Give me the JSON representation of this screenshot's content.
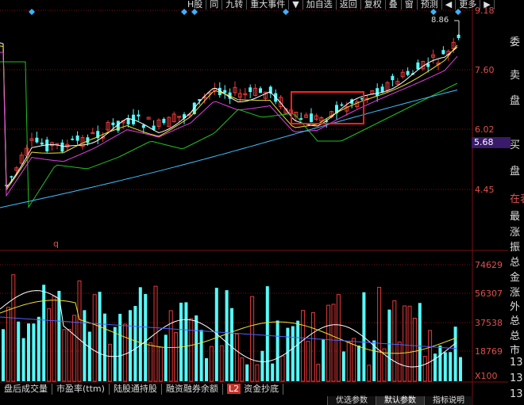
{
  "toolbar": {
    "items": [
      "H股",
      "同",
      "九转",
      "重大事件",
      "▼",
      "加自选",
      "返回",
      "复权",
      "叠",
      "窗",
      "预测",
      "◀",
      "更多",
      "▶"
    ]
  },
  "price_axis": {
    "labels": [
      "9.18",
      "7.60",
      "6.02",
      "4.45"
    ],
    "current_price": "5.68",
    "high_marker": "8.86"
  },
  "volume_axis": {
    "labels": [
      "74629",
      "56307",
      "37538",
      "18769",
      "X100"
    ]
  },
  "side_panel": {
    "items": [
      "委",
      "卖",
      "盘",
      "买",
      "盘",
      "在表",
      "最",
      "涨",
      "振",
      "总",
      "金",
      "涨",
      "外",
      "总",
      "总",
      "市",
      "13",
      "13",
      "13"
    ]
  },
  "annotation_char": "q",
  "bottom_tabs": {
    "items": [
      "盘后成交量",
      "市盈率(ttm)",
      "陆股通持股",
      "融资融券余额"
    ],
    "badge": "L2",
    "last": "资金抄底"
  },
  "param_tabs": {
    "items": [
      "优选参数",
      "默认参数",
      "指标说明"
    ]
  },
  "colors": {
    "up": "#e8393a",
    "down": "#54fcfc",
    "ma_white": "#ffffff",
    "ma_yellow": "#f0e030",
    "ma_magenta": "#e040e0",
    "ma_green": "#20c020",
    "ma_cyan": "#40c0ff",
    "highlight_box": "#ff2020",
    "grid": "#7a1010"
  }
}
